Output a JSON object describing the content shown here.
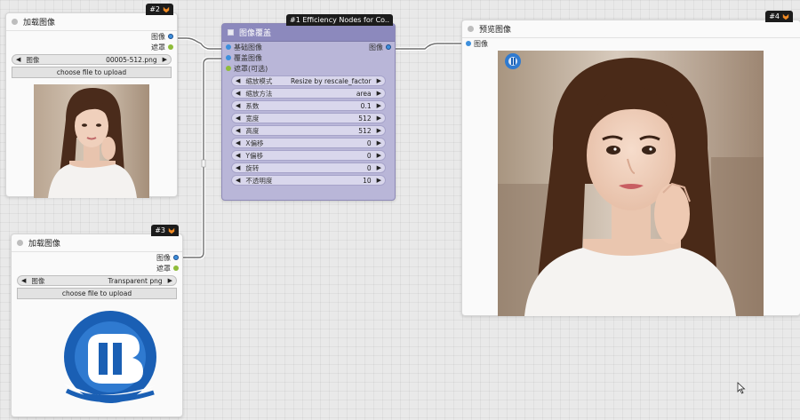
{
  "node2": {
    "badge": "#2",
    "title": "加载图像",
    "outputs": [
      "图像",
      "遮罩"
    ],
    "image_combo": {
      "label": "图像",
      "value": "00005-512.png"
    },
    "upload_label": "choose file to upload"
  },
  "node3": {
    "badge": "#3",
    "title": "加载图像",
    "outputs": [
      "图像",
      "遮罩"
    ],
    "image_combo": {
      "label": "图像",
      "value": "Transparent png"
    },
    "upload_label": "choose file to upload"
  },
  "node1": {
    "badge": "#1 Efficiency Nodes for Co..",
    "title": "图像覆盖",
    "inputs": [
      "基础图像",
      "覆盖图像",
      "遮罩(可选)"
    ],
    "output": "图像",
    "widgets": [
      {
        "label": "缩放模式",
        "value": "Resize by rescale_factor"
      },
      {
        "label": "缩放方法",
        "value": "area"
      },
      {
        "label": "系数",
        "value": "0.1"
      },
      {
        "label": "宽度",
        "value": "512"
      },
      {
        "label": "高度",
        "value": "512"
      },
      {
        "label": "X偏移",
        "value": "0"
      },
      {
        "label": "Y偏移",
        "value": "0"
      },
      {
        "label": "旋转",
        "value": "0"
      },
      {
        "label": "不透明度",
        "value": "10"
      }
    ]
  },
  "node4": {
    "badge": "#4",
    "title": "预览图像",
    "input": "图像"
  },
  "colors": {
    "overlay_node_body": "#b9b6d8",
    "overlay_node_header": "#8c89bd",
    "image_port": "#3d8fdc",
    "mask_port": "#8fbc3a",
    "logo_blue": "#1a5fb4"
  }
}
